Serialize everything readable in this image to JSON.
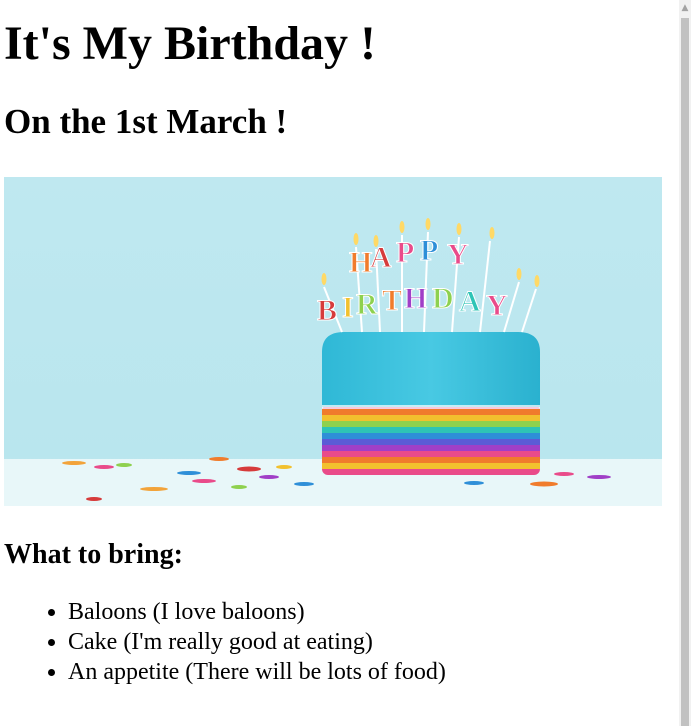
{
  "page": {
    "title": "It's My Birthday !",
    "subtitle": "On the 1st March !",
    "image": {
      "alt": "Birthday cake with HAPPY BIRTHDAY candles",
      "candle_text_line1": "HAPPY",
      "candle_text_line2": "BIRTHDAY"
    },
    "bring_heading": "What to bring:",
    "bring_items": [
      "Baloons (I love baloons)",
      "Cake (I'm really good at eating)",
      "An appetite (There will be lots of food)"
    ]
  },
  "scrollbar": {
    "up_icon": "chevron-up-icon"
  },
  "colors": {
    "background": "#ffffff",
    "sky": "#bfe8f0",
    "cake_top": "#3cc6e0",
    "scrollbar_track": "#f1f1f1",
    "scrollbar_thumb": "#c1c1c1"
  }
}
